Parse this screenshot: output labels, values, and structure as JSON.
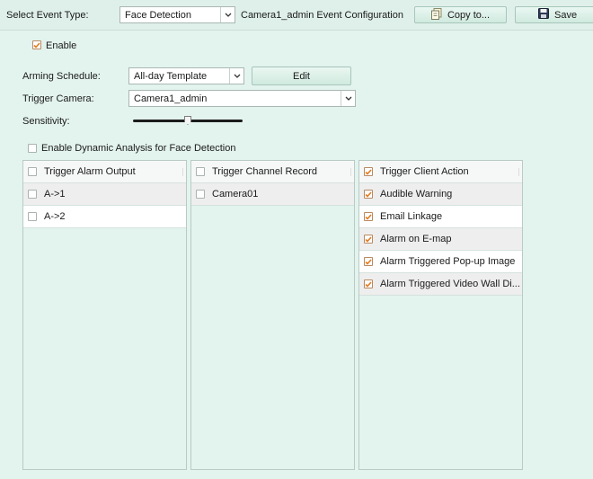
{
  "toolbar": {
    "event_type_label": "Select Event Type:",
    "event_type_value": "Face Detection",
    "config_title": "Camera1_admin Event Configuration",
    "copy_label": "Copy to...",
    "save_label": "Save"
  },
  "enable": {
    "label": "Enable",
    "checked": true
  },
  "arming": {
    "label": "Arming Schedule:",
    "value": "All-day Template",
    "edit_label": "Edit"
  },
  "trigger_camera": {
    "label": "Trigger Camera:",
    "value": "Camera1_admin"
  },
  "sensitivity": {
    "label": "Sensitivity:",
    "level": 0.5
  },
  "dynamic_analysis": {
    "label": "Enable Dynamic Analysis for Face Detection",
    "checked": false
  },
  "panels": {
    "alarm_output": {
      "header": "Trigger Alarm Output",
      "items": [
        {
          "label": "A->1",
          "checked": false
        },
        {
          "label": "A->2",
          "checked": false
        }
      ]
    },
    "channel_record": {
      "header": "Trigger Channel Record",
      "items": [
        {
          "label": "Camera01",
          "checked": false
        }
      ]
    },
    "client_action": {
      "header": "Trigger Client Action",
      "items": [
        {
          "label": "Audible Warning",
          "checked": true
        },
        {
          "label": "Email Linkage",
          "checked": true
        },
        {
          "label": "Alarm on E-map",
          "checked": true
        },
        {
          "label": "Alarm Triggered Pop-up Image",
          "checked": true
        },
        {
          "label": "Alarm Triggered Video Wall Di...",
          "checked": true
        }
      ]
    }
  },
  "colors": {
    "background": "#e3f3ee",
    "check": "#e07b20",
    "button": "#d0eadf"
  },
  "icons": {
    "copy": "copy-icon",
    "save": "save-icon",
    "dropdown": "chevron-down-icon",
    "check": "checkmark-icon"
  }
}
